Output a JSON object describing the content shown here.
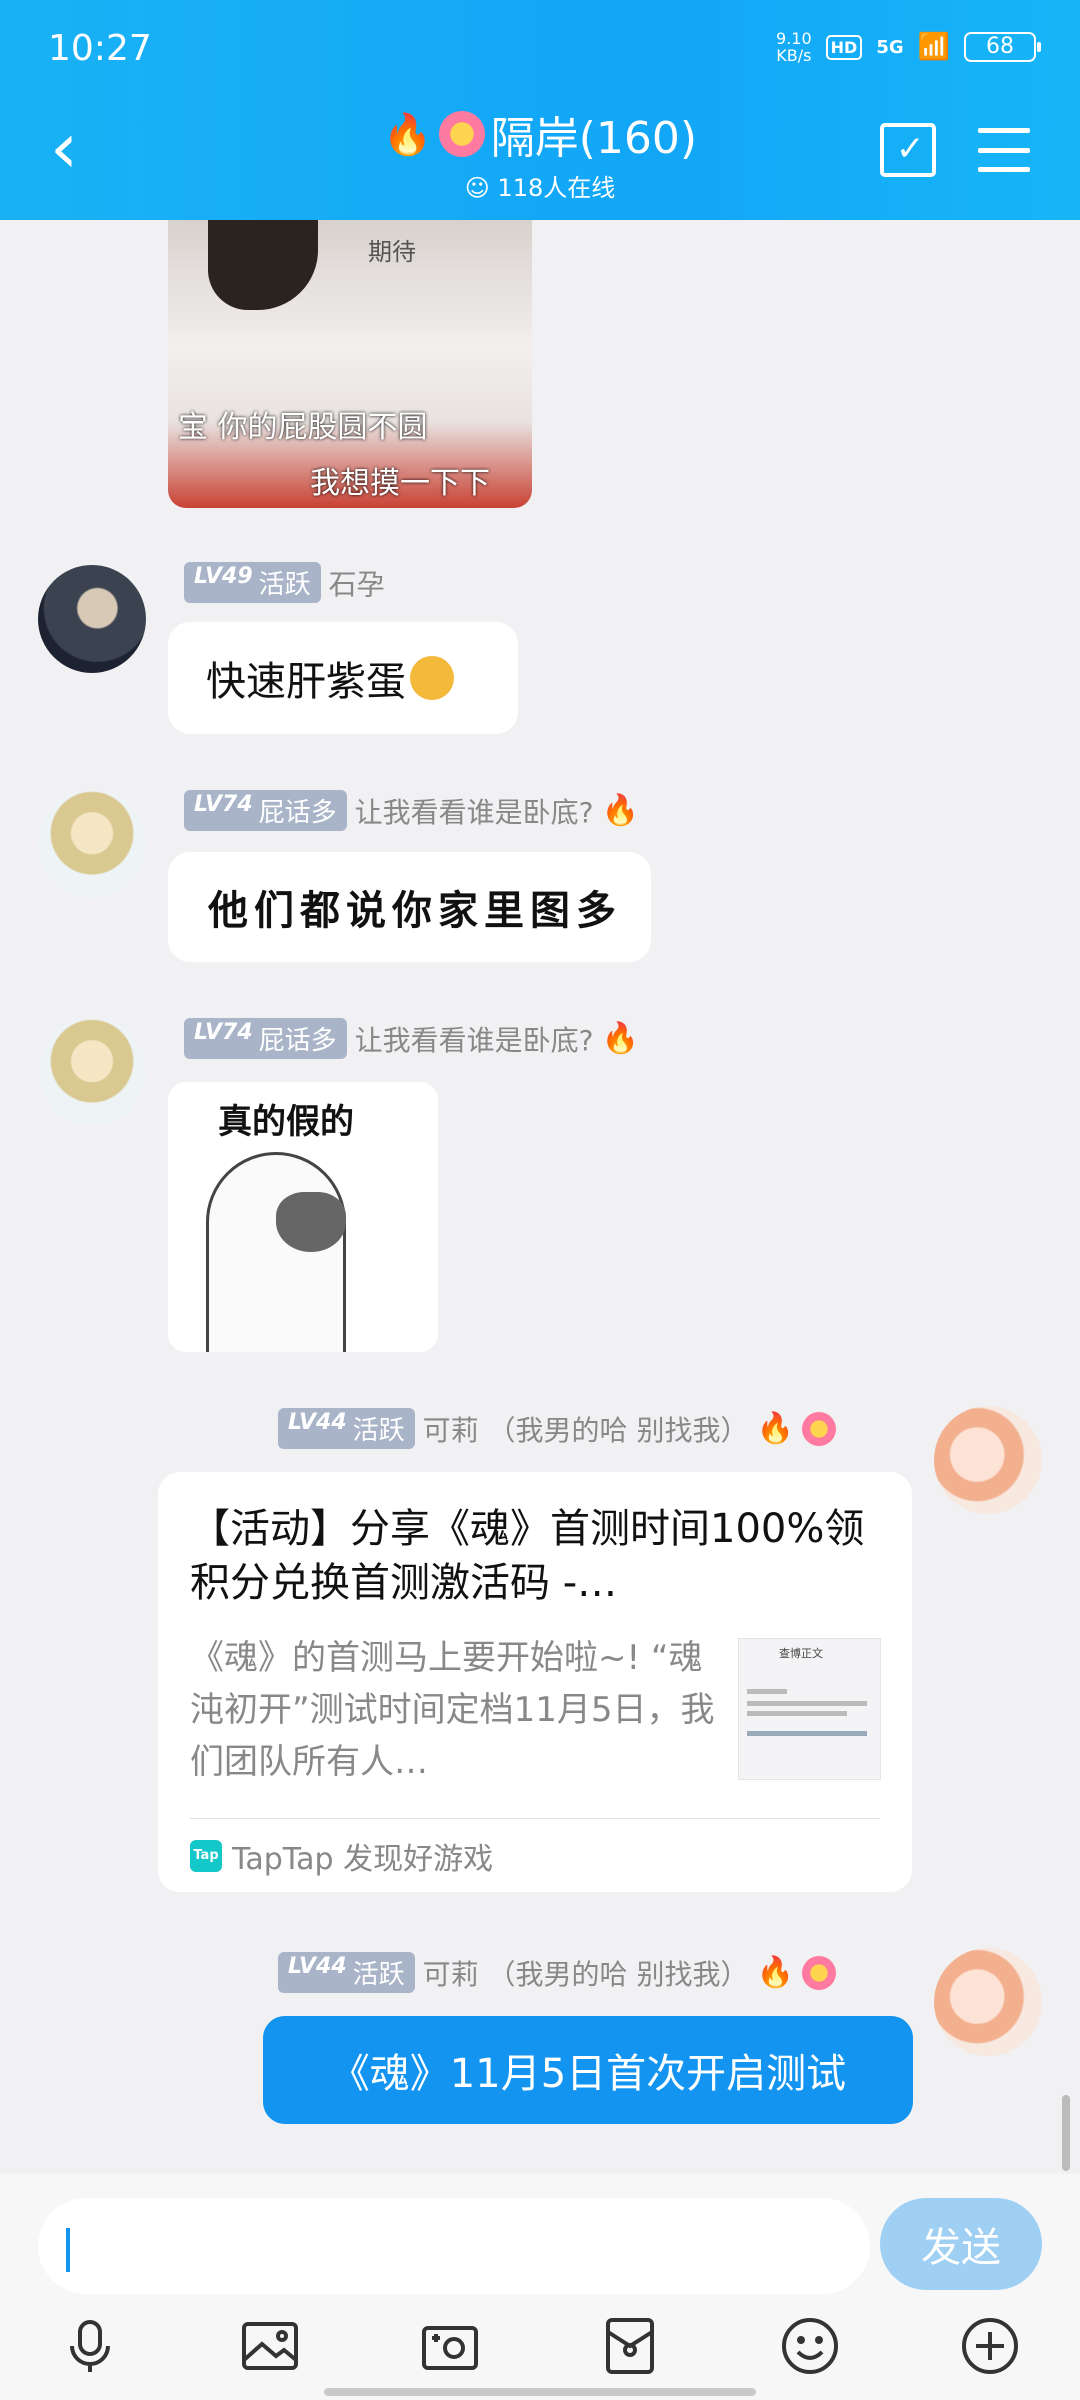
{
  "status_bar": {
    "time": "10:27",
    "net_speed": "9.10",
    "net_unit": "KB/s",
    "hd": "HD",
    "signal": "5G",
    "battery": "68"
  },
  "header": {
    "title": "隔岸(160)",
    "online": "118人在线"
  },
  "messages": {
    "meme1": {
      "top_text": "期待",
      "line1": "宝 你的屁股圆不圆",
      "line2": "我想摸一下下"
    },
    "msg1": {
      "level": "LV49",
      "tag": "活跃",
      "name": "石孕",
      "text": "快速肝紫蛋"
    },
    "msg2": {
      "level": "LV74",
      "tag": "屁话多",
      "name": "让我看看谁是卧底?",
      "text": "他们都说你家里图多"
    },
    "msg3": {
      "level": "LV74",
      "tag": "屁话多",
      "name": "让我看看谁是卧底?",
      "caption": "真的假的"
    },
    "msg4": {
      "level": "LV44",
      "tag": "活跃",
      "name": "可莉 （我男的哈 别找我）",
      "card_title": "【活动】分享《魂》首测时间100%领积分兑换首测激活码 -…",
      "card_desc": "《魂》的首测马上要开始啦~! “魂沌初开”测试时间定档11月5日，我们团队所有人…",
      "card_source": "TapTap 发现好游戏",
      "thumb_title": "查博正文"
    },
    "msg5": {
      "level": "LV44",
      "tag": "活跃",
      "name": "可莉 （我男的哈 别找我）",
      "text": "《魂》11月5日首次开启测试"
    }
  },
  "input": {
    "placeholder": "",
    "send_label": "发送"
  },
  "toolbar_icons": [
    "microphone-icon",
    "image-icon",
    "camera-icon",
    "red-packet-icon",
    "emoji-icon",
    "plus-icon"
  ]
}
